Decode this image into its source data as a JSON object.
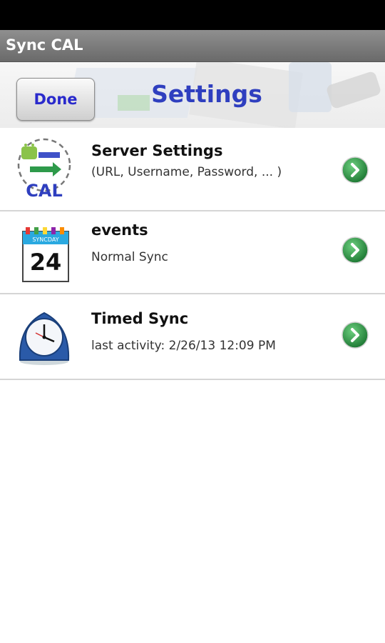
{
  "app": {
    "title": "Sync CAL"
  },
  "header": {
    "done_label": "Done",
    "title": "Settings"
  },
  "rows": [
    {
      "title": "Server Settings",
      "subtitle": "(URL, Username, Password, ... )",
      "icon": "cal-sync-icon"
    },
    {
      "title": "events",
      "subtitle": "Normal Sync",
      "icon": "calendar-icon",
      "calendar_day": "24",
      "calendar_header": "SYNCDAY"
    },
    {
      "title": "Timed Sync",
      "subtitle": "last activity:  2/26/13  12:09 PM",
      "icon": "alarm-clock-icon"
    }
  ],
  "colors": {
    "accent": "#2f3fbf",
    "chevron": "#2e9a4a"
  }
}
